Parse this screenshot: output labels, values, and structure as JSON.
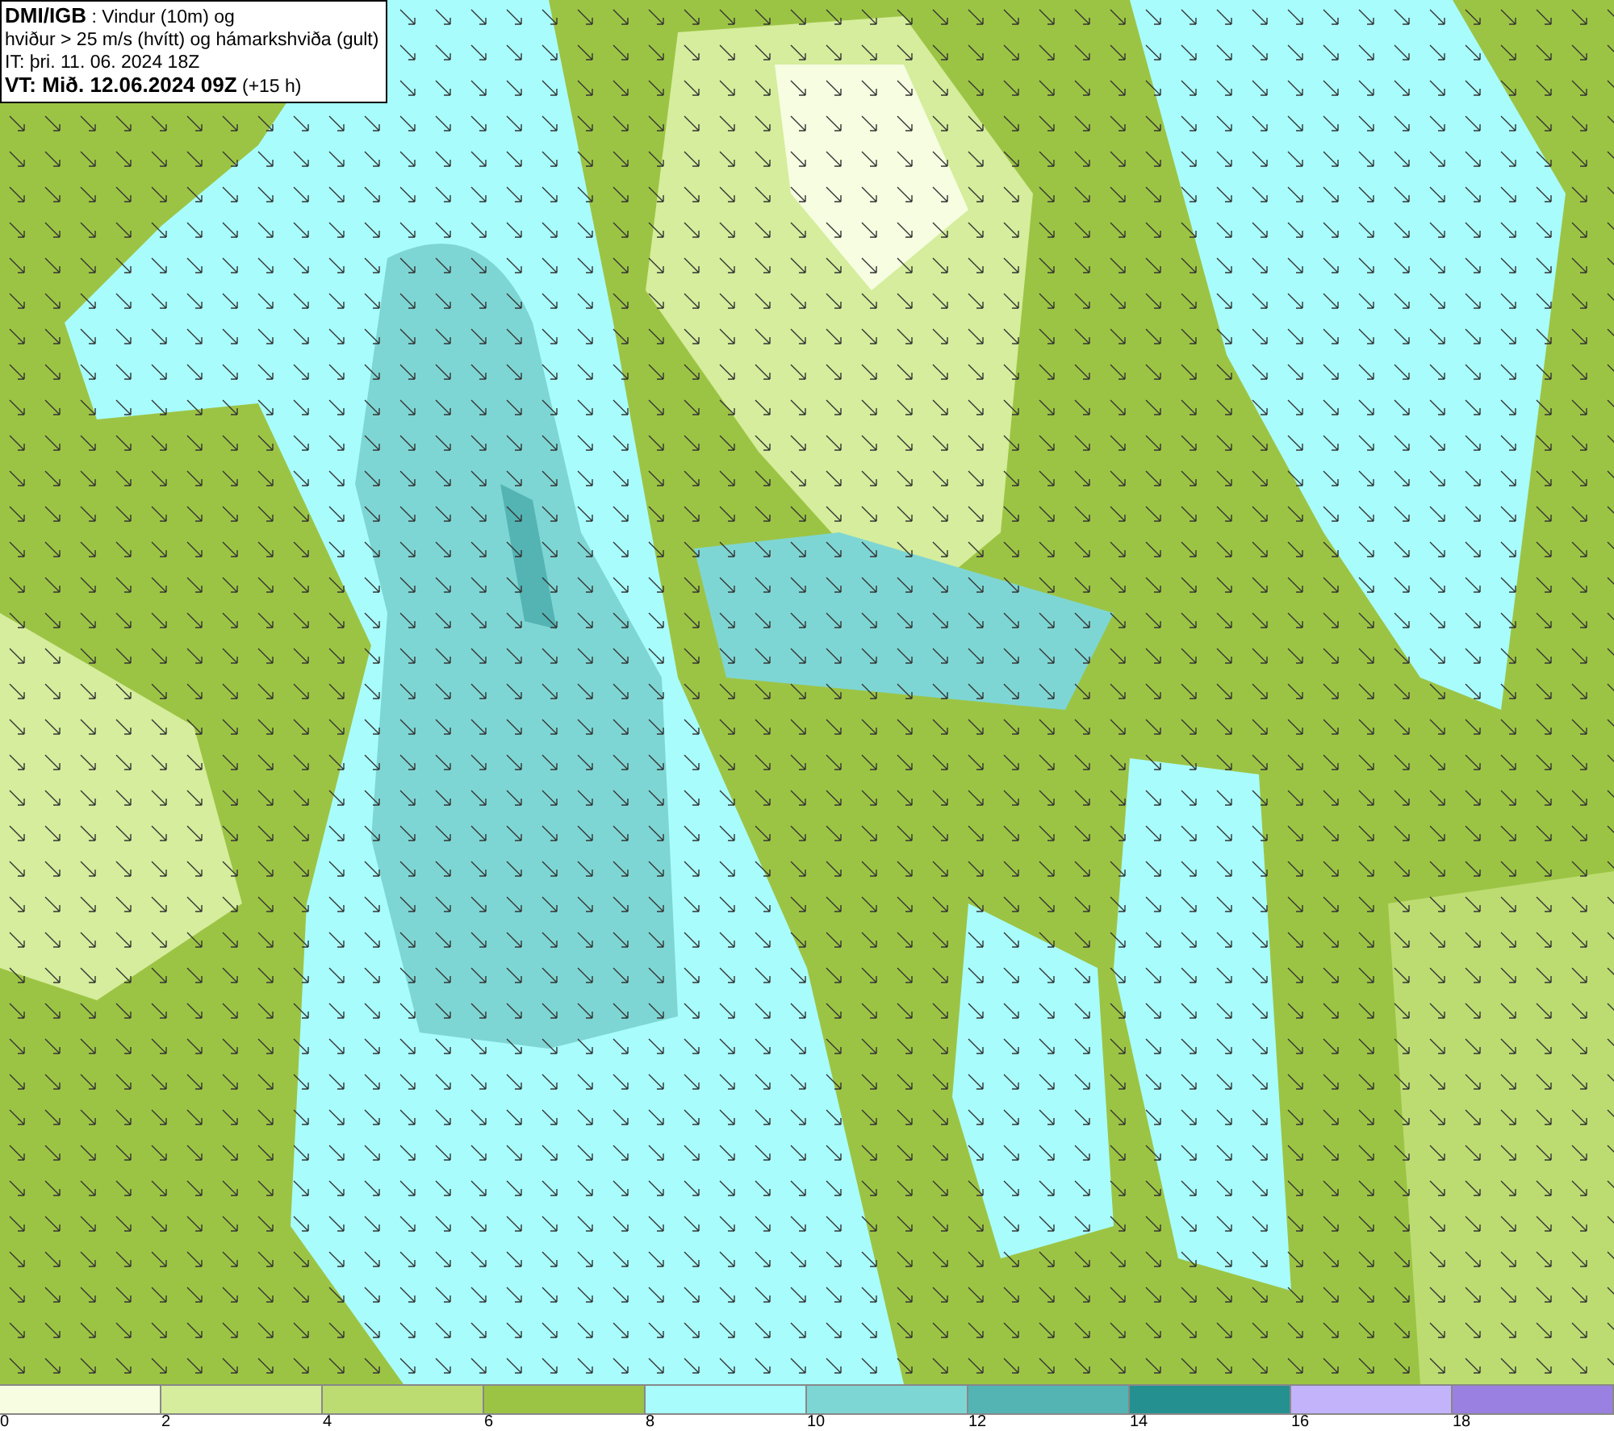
{
  "info": {
    "lines": [
      "**DMI/IGB** : Vindur (10m) og",
      "hviður > 25 m/s (hvítt) og hámarkshviða (gult)",
      "IT: þri. 11. 06. 2024 18Z",
      "**VT: Mið. 12.06.2024 09Z** (+15 h)"
    ]
  },
  "legend": [
    {
      "label": "0",
      "color": "#f6fde0"
    },
    {
      "label": "2",
      "color": "#d5ed9c"
    },
    {
      "label": "4",
      "color": "#bcdc72"
    },
    {
      "label": "6",
      "color": "#9cc444"
    },
    {
      "label": "8",
      "color": "#a8fcfc"
    },
    {
      "label": "10",
      "color": "#7ed6d4"
    },
    {
      "label": "12",
      "color": "#54b4b4"
    },
    {
      "label": "14",
      "color": "#259090"
    },
    {
      "label": "16",
      "color": "#c3b3fb"
    },
    {
      "label": "18",
      "color": "#9a80e0"
    }
  ]
}
